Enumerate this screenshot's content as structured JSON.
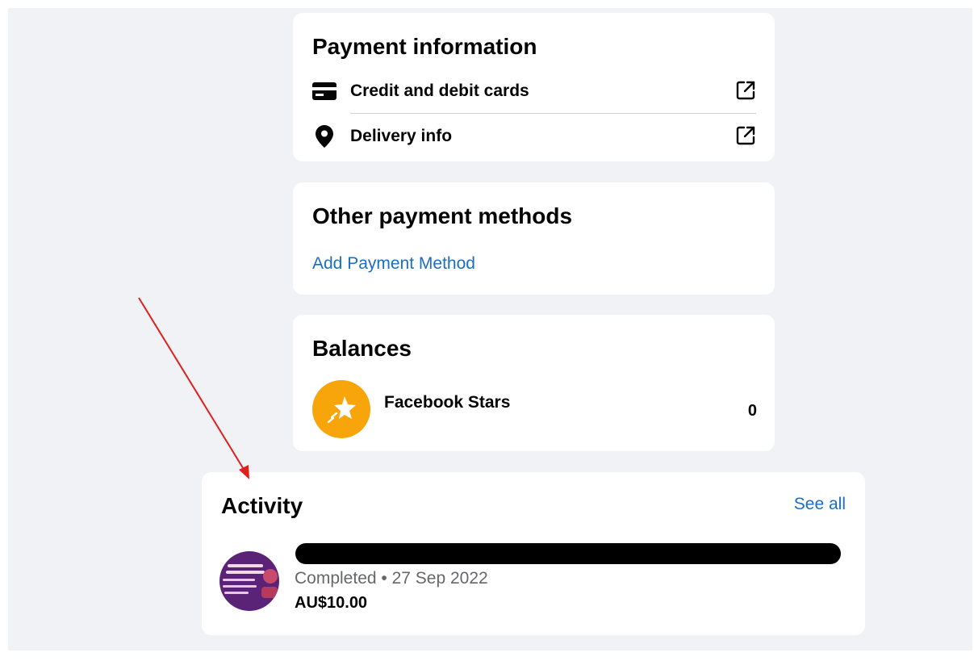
{
  "payment_information": {
    "title": "Payment information",
    "items": [
      {
        "label": "Credit and debit cards",
        "icon": "credit-card-icon",
        "action_icon": "external-link-icon"
      },
      {
        "label": "Delivery info",
        "icon": "location-pin-icon",
        "action_icon": "external-link-icon"
      }
    ]
  },
  "other_payment_methods": {
    "title": "Other payment methods",
    "add_link": "Add Payment Method"
  },
  "balances": {
    "title": "Balances",
    "items": [
      {
        "name": "Facebook Stars",
        "value": "0",
        "icon": "stars-icon"
      }
    ]
  },
  "activity": {
    "title": "Activity",
    "see_all": "See all",
    "items": [
      {
        "status": "Completed • 27 Sep 2022",
        "amount": "AU$10.00"
      }
    ]
  },
  "colors": {
    "link": "#1b6ec2",
    "background": "#f0f2f5",
    "card": "#ffffff",
    "star_badge": "#f7a50b",
    "annotation_arrow": "#e0201f"
  }
}
